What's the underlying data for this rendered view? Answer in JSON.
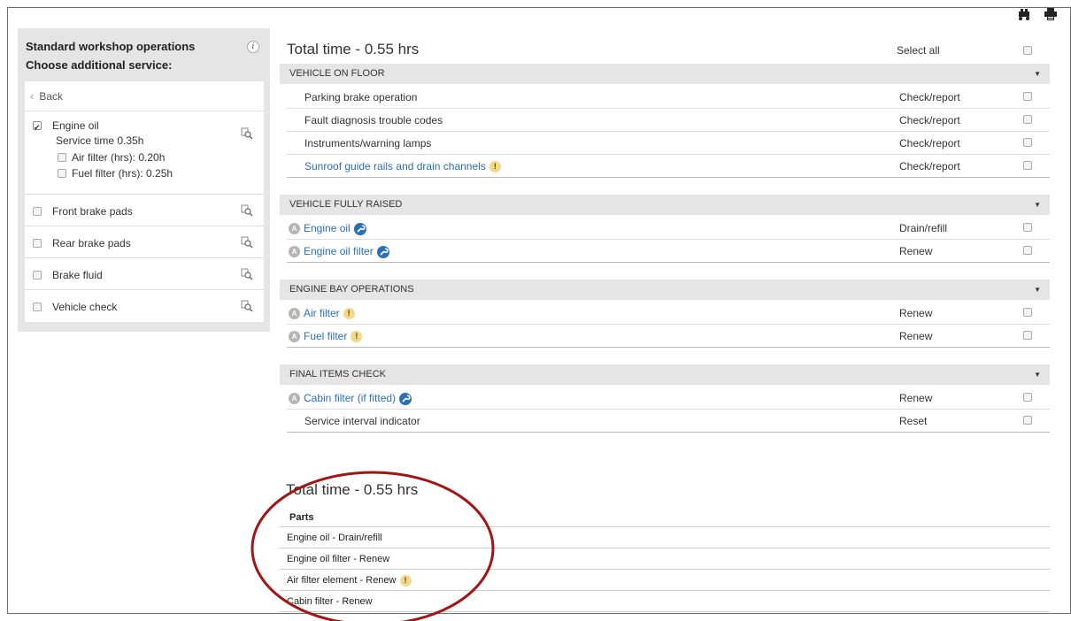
{
  "left_panel": {
    "title": "Standard workshop operations",
    "subtitle": "Choose additional service:",
    "back_label": "Back",
    "engine_oil": {
      "label": "Engine oil",
      "service_time": "Service time 0.35h",
      "sub_items": [
        {
          "label": "Air filter (hrs): 0.20h",
          "checked": false
        },
        {
          "label": "Fuel filter (hrs): 0.25h",
          "checked": false
        }
      ],
      "checked": true
    },
    "items": [
      {
        "label": "Front brake pads",
        "checked": false
      },
      {
        "label": "Rear brake pads",
        "checked": false
      },
      {
        "label": "Brake fluid",
        "checked": false
      },
      {
        "label": "Vehicle check",
        "checked": false
      }
    ]
  },
  "main": {
    "total_time": "Total time - 0.55 hrs",
    "select_all": "Select all",
    "sections": [
      {
        "title": "VEHICLE ON FLOOR",
        "rows": [
          {
            "name": "Parking brake operation",
            "op": "Check/report"
          },
          {
            "name": "Fault diagnosis trouble codes",
            "op": "Check/report"
          },
          {
            "name": "Instruments/warning lamps",
            "op": "Check/report"
          },
          {
            "name": "Sunroof guide rails and drain channels",
            "op": "Check/report"
          }
        ]
      },
      {
        "title": "VEHICLE FULLY RAISED",
        "rows": [
          {
            "badge": "A",
            "name": "Engine oil",
            "op": "Drain/refill"
          },
          {
            "badge": "A",
            "name": "Engine oil filter",
            "op": "Renew"
          }
        ]
      },
      {
        "title": "ENGINE BAY OPERATIONS",
        "rows": [
          {
            "badge": "A",
            "name": "Air filter",
            "op": "Renew"
          },
          {
            "badge": "A",
            "name": "Fuel filter",
            "op": "Renew"
          }
        ]
      },
      {
        "title": "FINAL ITEMS CHECK",
        "rows": [
          {
            "badge": "A",
            "name": "Cabin filter (if fitted)",
            "op": "Renew"
          },
          {
            "name": "Service interval indicator",
            "op": "Reset"
          }
        ]
      }
    ]
  },
  "summary": {
    "total_time": "Total time - 0.55 hrs",
    "parts_header": "Parts",
    "parts": [
      "Engine oil - Drain/refill",
      "Engine oil filter - Renew",
      "Air filter element - Renew",
      "Cabin filter - Renew"
    ]
  },
  "colors": {
    "link": "#2c6fb7",
    "section_bg": "#e5e5e5",
    "warning": "#f4d88a",
    "annotation_circle": "#a31515"
  },
  "icons": [
    "vehicle-icon",
    "print-icon",
    "info-icon",
    "zoom-search-icon",
    "wrench-icon",
    "warning-icon",
    "a-badge-icon",
    "caret-down-icon"
  ]
}
